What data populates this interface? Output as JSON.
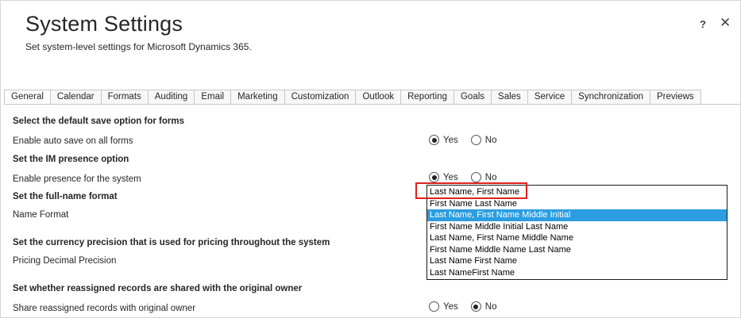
{
  "header": {
    "title": "System Settings",
    "subtitle": "Set system-level settings for Microsoft Dynamics 365.",
    "help_label": "?",
    "close_label": "✕"
  },
  "tabs": [
    {
      "label": "General",
      "active": true
    },
    {
      "label": "Calendar"
    },
    {
      "label": "Formats"
    },
    {
      "label": "Auditing"
    },
    {
      "label": "Email"
    },
    {
      "label": "Marketing"
    },
    {
      "label": "Customization"
    },
    {
      "label": "Outlook"
    },
    {
      "label": "Reporting"
    },
    {
      "label": "Goals"
    },
    {
      "label": "Sales"
    },
    {
      "label": "Service"
    },
    {
      "label": "Synchronization"
    },
    {
      "label": "Previews"
    }
  ],
  "sections": {
    "save": {
      "header": "Select the default save option for forms",
      "label": "Enable auto save on all forms",
      "yes": "Yes",
      "no": "No",
      "value": "Yes"
    },
    "im": {
      "header": "Set the IM presence option",
      "label": "Enable presence for the system",
      "yes": "Yes",
      "no": "No",
      "value": "Yes"
    },
    "fullname": {
      "header": "Set the full-name format",
      "label": "Name Format",
      "options": [
        "Last Name, First Name",
        "First Name Last Name",
        "Last Name, First Name Middle Initial",
        "First Name Middle Initial Last Name",
        "Last Name, First Name Middle Name",
        "First Name Middle Name Last Name",
        "Last Name First Name",
        "Last NameFirst Name"
      ],
      "selected_index": 2
    },
    "currency": {
      "header": "Set the currency precision that is used for pricing throughout the system",
      "label": "Pricing Decimal Precision"
    },
    "reassign": {
      "header": "Set whether reassigned records are shared with the original owner",
      "label": "Share reassigned records with original owner",
      "yes": "Yes",
      "no": "No",
      "value": "No"
    }
  },
  "colors": {
    "selected_option": "#2b9de0",
    "highlight_box": "#e02020"
  }
}
